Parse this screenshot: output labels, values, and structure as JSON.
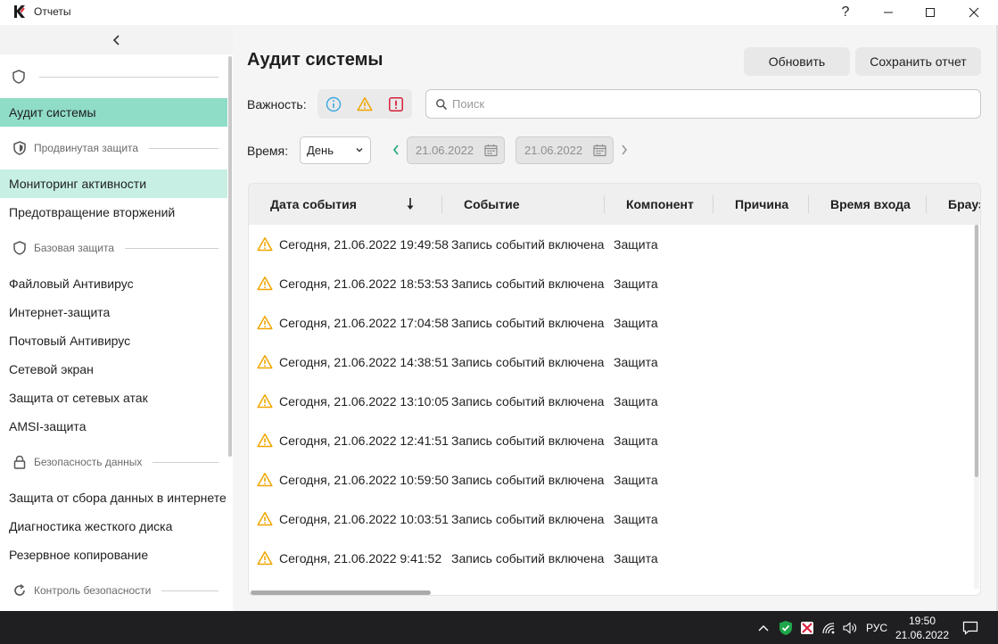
{
  "window": {
    "title": "Отчеты"
  },
  "sidebar": {
    "active": "Аудит системы",
    "items": [
      {
        "label": "Аудит системы",
        "state": "active"
      },
      {
        "section": "Продвинутая защита",
        "icon": "shield-filled-icon"
      },
      {
        "label": "Мониторинг активности",
        "state": "hover"
      },
      {
        "label": "Предотвращение вторжений"
      },
      {
        "section": "Базовая защита",
        "icon": "shield-outline-icon"
      },
      {
        "label": "Файловый Антивирус"
      },
      {
        "label": "Интернет-защита"
      },
      {
        "label": "Почтовый Антивирус"
      },
      {
        "label": "Сетевой экран"
      },
      {
        "label": "Защита от сетевых атак"
      },
      {
        "label": "AMSI-защита"
      },
      {
        "section": "Безопасность данных",
        "icon": "lock-icon"
      },
      {
        "label": "Защита от сбора данных в интернете"
      },
      {
        "label": "Диагностика жесткого диска"
      },
      {
        "label": "Резервное копирование"
      },
      {
        "section": "Контроль безопасности",
        "icon": "refresh-shield-icon"
      }
    ]
  },
  "main": {
    "title": "Аудит системы",
    "refresh_label": "Обновить",
    "save_label": "Сохранить отчет",
    "severity_label": "Важность:",
    "search_placeholder": "Поиск",
    "time_label": "Время:",
    "period_value": "День",
    "date_from": "21.06.2022",
    "date_to": "21.06.2022"
  },
  "table": {
    "columns": [
      "Дата события",
      "Событие",
      "Компонент",
      "Причина",
      "Время входа",
      "Брауз"
    ],
    "rows": [
      {
        "date": "Сегодня, 21.06.2022 19:49:58",
        "event": "Запись событий включена",
        "component": "Защита"
      },
      {
        "date": "Сегодня, 21.06.2022 18:53:53",
        "event": "Запись событий включена",
        "component": "Защита"
      },
      {
        "date": "Сегодня, 21.06.2022 17:04:58",
        "event": "Запись событий включена",
        "component": "Защита"
      },
      {
        "date": "Сегодня, 21.06.2022 14:38:51",
        "event": "Запись событий включена",
        "component": "Защита"
      },
      {
        "date": "Сегодня, 21.06.2022 13:10:05",
        "event": "Запись событий включена",
        "component": "Защита"
      },
      {
        "date": "Сегодня, 21.06.2022 12:41:51",
        "event": "Запись событий включена",
        "component": "Защита"
      },
      {
        "date": "Сегодня, 21.06.2022 10:59:50",
        "event": "Запись событий включена",
        "component": "Защита"
      },
      {
        "date": "Сегодня, 21.06.2022 10:03:51",
        "event": "Запись событий включена",
        "component": "Защита"
      },
      {
        "date": "Сегодня, 21.06.2022 9:41:52",
        "event": "Запись событий включена",
        "component": "Защита"
      }
    ]
  },
  "taskbar": {
    "language": "РУС",
    "time": "19:50",
    "date": "21.06.2022"
  },
  "colors": {
    "accent": "#8fdcc7",
    "hover": "#c7efe3",
    "warning": "#f0a500",
    "info": "#3aa6e0",
    "danger": "#d81f3a",
    "nav_arrow": "#1aa37a"
  }
}
